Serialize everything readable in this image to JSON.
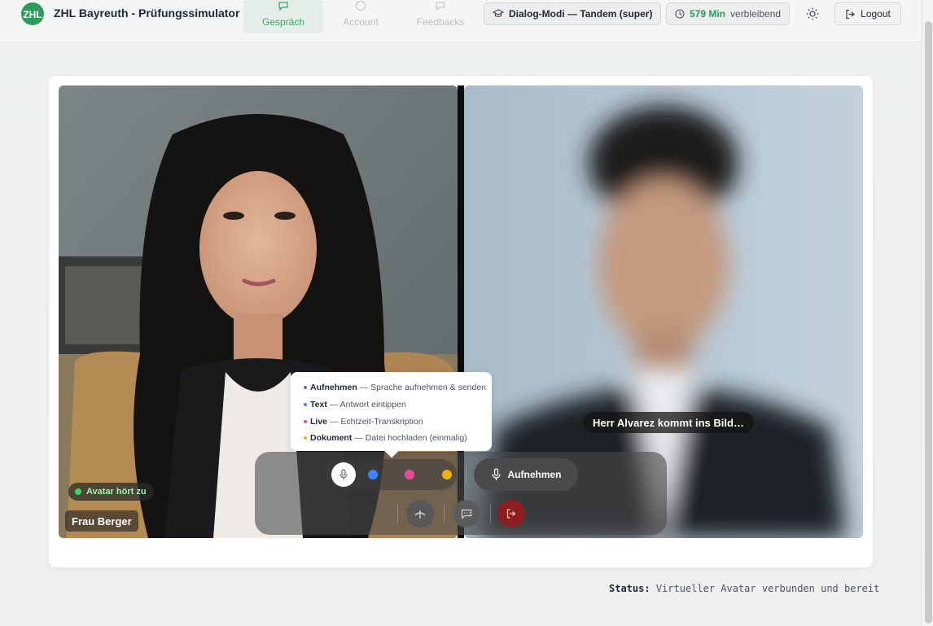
{
  "header": {
    "brand": "ZHL Bayreuth - Prüfungssimulator",
    "logo_text": "ZHL",
    "tabs": [
      {
        "label": "Gespräch",
        "icon": "chat-icon",
        "active": true
      },
      {
        "label": "Account",
        "icon": "user-circle-icon",
        "active": false
      },
      {
        "label": "Feedbacks",
        "icon": "message-icon",
        "active": false
      }
    ],
    "dialog_mode": "Dialog-Modi — Tandem (super)",
    "remaining_value": "579 Min",
    "remaining_label": "verbleibend",
    "logout_label": "Logout"
  },
  "video": {
    "left_status": "Avatar hört zu",
    "left_name": "Frau Berger",
    "right_caption": "Herr Alvarez kommt ins Bild…"
  },
  "controls": {
    "record_label": "Aufnehmen",
    "mode_colors": {
      "text": "#3b82f6",
      "live": "#ec4899",
      "document": "#eab308"
    },
    "end_color": "#8b1e1e"
  },
  "tooltip": {
    "rows": [
      {
        "title": "Aufnehmen",
        "desc": "— Sprache aufnehmen & senden",
        "color": "#6b7280"
      },
      {
        "title": "Text",
        "desc": "— Antwort eintippen",
        "color": "#3b82f6"
      },
      {
        "title": "Live",
        "desc": "— Echtzeit-Transkription",
        "color": "#ec4899"
      },
      {
        "title": "Dokument",
        "desc": "— Datei hochladen (einmalig)",
        "color": "#eab308"
      }
    ]
  },
  "status": {
    "label": "Status:",
    "value": "Virtueller Avatar verbunden und bereit"
  }
}
